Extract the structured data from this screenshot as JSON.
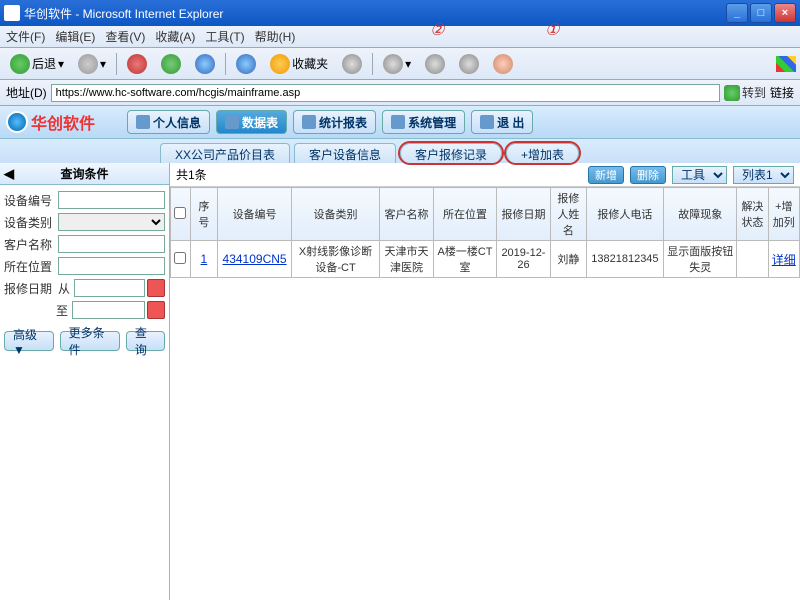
{
  "window": {
    "title": "华创软件 - Microsoft Internet Explorer"
  },
  "menu": {
    "file": "文件(F)",
    "edit": "编辑(E)",
    "view": "查看(V)",
    "fav": "收藏(A)",
    "tools": "工具(T)",
    "help": "帮助(H)"
  },
  "tb": {
    "back": "后退",
    "fav": "收藏夹"
  },
  "addr": {
    "label": "地址(D)",
    "url": "https://www.hc-software.com/hcgis/mainframe.asp",
    "go": "转到",
    "links": "链接"
  },
  "brand": "华创软件",
  "nav": {
    "profile": "个人信息",
    "data": "数据表",
    "report": "统计报表",
    "sys": "系统管理",
    "exit": "退 出"
  },
  "tabs": {
    "t1": "XX公司产品价目表",
    "t2": "客户设备信息",
    "t3": "客户报修记录",
    "t4": "+增加表"
  },
  "annot": {
    "a1": "①",
    "a2": "②"
  },
  "side": {
    "title": "查询条件",
    "f1": "设备编号",
    "f2": "设备类别",
    "f3": "客户名称",
    "f4": "所在位置",
    "f5": "报修日期",
    "from": "从",
    "to": "至",
    "adv": "高级▼",
    "more": "更多条件",
    "search": "查询"
  },
  "main": {
    "count": "共1条",
    "new": "新增",
    "del": "删除",
    "tool": "工具",
    "list": "列表1"
  },
  "cols": {
    "c0": "",
    "c1": "序号",
    "c2": "设备编号",
    "c3": "设备类别",
    "c4": "客户名称",
    "c5": "所在位置",
    "c6": "报修日期",
    "c7": "报修人姓名",
    "c8": "报修人电话",
    "c9": "故障现象",
    "c10": "解决状态",
    "c11": "+增加列"
  },
  "row": {
    "seq": "1",
    "code": "434109CN5",
    "type": "X射线影像诊断设备-CT",
    "cust": "天津市天津医院",
    "loc": "A楼一楼CT室",
    "date": "2019-12-26",
    "person": "刘静",
    "phone": "13821812345",
    "fault": "显示面版按钮失灵",
    "status": "",
    "detail": "详细"
  }
}
